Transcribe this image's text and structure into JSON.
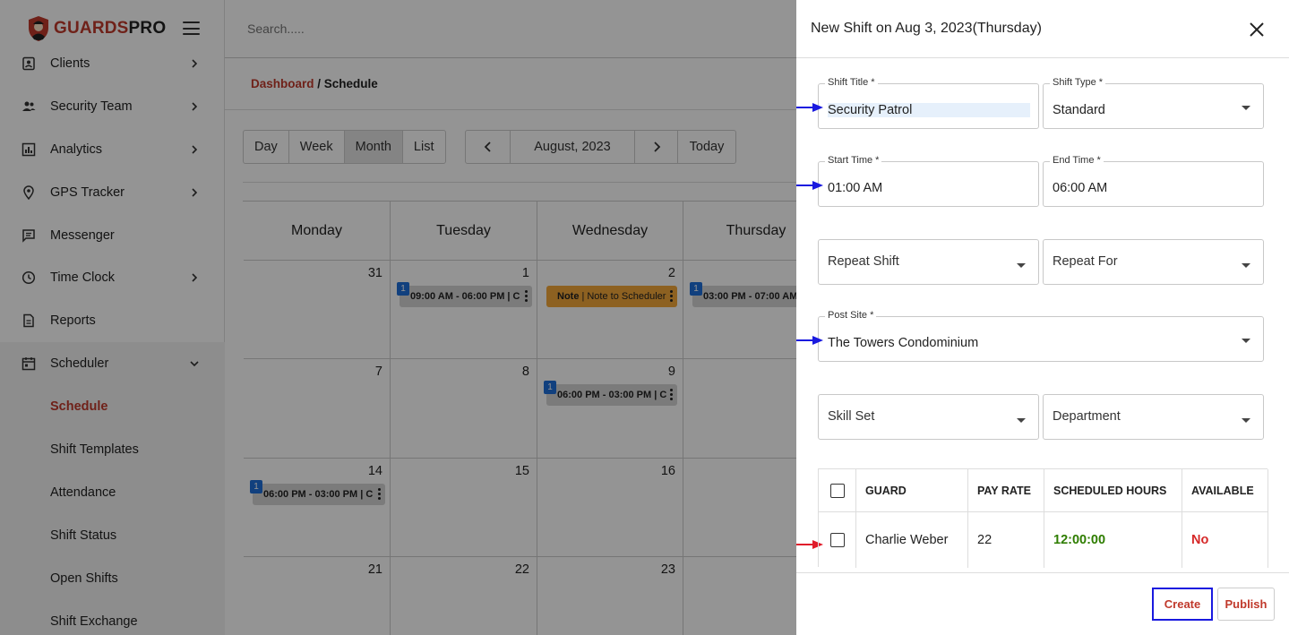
{
  "brand": {
    "part1": "GUARDS",
    "part2": "PRO"
  },
  "search": {
    "placeholder": "Search....."
  },
  "sidebar": {
    "items": [
      {
        "label": "Clients",
        "icon": "clients-icon",
        "expandable": true
      },
      {
        "label": "Security Team",
        "icon": "people-icon",
        "expandable": true
      },
      {
        "label": "Analytics",
        "icon": "chart-icon",
        "expandable": true
      },
      {
        "label": "GPS Tracker",
        "icon": "location-pin-icon",
        "expandable": true
      },
      {
        "label": "Messenger",
        "icon": "message-icon",
        "expandable": false
      },
      {
        "label": "Time Clock",
        "icon": "clock-icon",
        "expandable": true
      },
      {
        "label": "Reports",
        "icon": "document-icon",
        "expandable": false
      },
      {
        "label": "Scheduler",
        "icon": "calendar-icon",
        "expandable": true,
        "expanded": true
      }
    ],
    "subitems": [
      {
        "label": "Schedule",
        "active": true
      },
      {
        "label": "Shift Templates"
      },
      {
        "label": "Attendance"
      },
      {
        "label": "Shift Status"
      },
      {
        "label": "Open Shifts"
      },
      {
        "label": "Shift Exchange"
      }
    ]
  },
  "breadcrumb": {
    "link": "Dashboard",
    "sep": " / ",
    "current": "Schedule"
  },
  "calendar": {
    "views": [
      "Day",
      "Week",
      "Month",
      "List"
    ],
    "selected_view": "Month",
    "month_label": "August, 2023",
    "today_label": "Today",
    "weekdays": [
      "Monday",
      "Tuesday",
      "Wednesday",
      "Thursday"
    ],
    "weeks": [
      [
        "31",
        "1",
        "2",
        ""
      ],
      [
        "7",
        "8",
        "9",
        ""
      ],
      [
        "14",
        "15",
        "16",
        ""
      ],
      [
        "21",
        "22",
        "23",
        ""
      ]
    ],
    "events": [
      {
        "text": "09:00 AM - 06:00 PM | C",
        "badge": "1"
      },
      {
        "bold": "Note",
        "text": "| Note to Scheduler"
      },
      {
        "text": "03:00 PM - 07:00 AM",
        "badge": "1"
      },
      {
        "text": "06:00 PM - 03:00 PM | C",
        "badge": "1"
      },
      {
        "text": "06:00 PM - 03:00 PM | C",
        "badge": "1"
      }
    ]
  },
  "drawer": {
    "title": "New Shift on Aug 3, 2023(Thursday)",
    "fields": {
      "shift_title": {
        "label": "Shift Title *",
        "value": "Security Patrol"
      },
      "shift_type": {
        "label": "Shift Type *",
        "value": "Standard"
      },
      "start_time": {
        "label": "Start Time *",
        "value": "01:00 AM"
      },
      "end_time": {
        "label": "End Time *",
        "value": "06:00 AM"
      },
      "repeat_shift": {
        "placeholder": "Repeat Shift"
      },
      "repeat_for": {
        "placeholder": "Repeat For"
      },
      "post_site": {
        "label": "Post Site *",
        "value": "The Towers Condominium"
      },
      "skill_set": {
        "placeholder": "Skill Set"
      },
      "department": {
        "placeholder": "Department"
      }
    },
    "table": {
      "headers": [
        "GUARD",
        "PAY RATE",
        "SCHEDULED HOURS",
        "AVAILABLE"
      ],
      "rows": [
        {
          "guard": "Charlie Weber",
          "pay_rate": "22",
          "hours": "12:00:00",
          "available": "No"
        }
      ]
    },
    "buttons": {
      "create": "Create",
      "publish": "Publish"
    }
  },
  "colors": {
    "accent": "#c0392b",
    "arrow_blue": "#1a1adf",
    "arrow_red": "#e01b2a",
    "hours_green": "#2e7d00"
  }
}
